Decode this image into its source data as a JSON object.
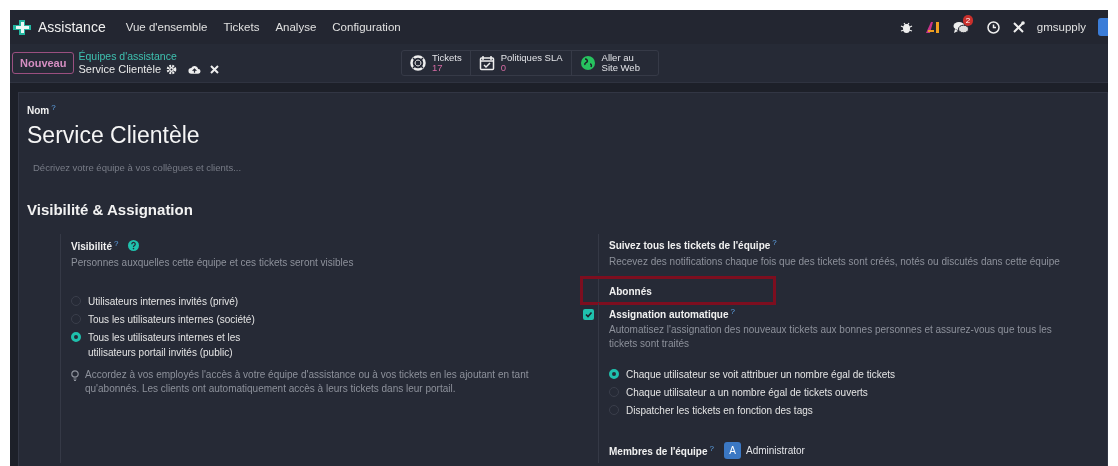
{
  "navbar": {
    "app_name": "Assistance",
    "menu": [
      "Vue d'ensemble",
      "Tickets",
      "Analyse",
      "Configuration"
    ],
    "chat_badge": "2",
    "user": "gmsupply"
  },
  "control_panel": {
    "new_button": "Nouveau",
    "breadcrumb": "Équipes d'assistance",
    "record": "Service Clientèle",
    "stat_buttons": [
      {
        "kind": "tickets",
        "label": "Tickets",
        "value": "17"
      },
      {
        "kind": "sla",
        "label": "Politiques SLA",
        "value": "0"
      },
      {
        "kind": "website",
        "label": "Aller au Site Web"
      }
    ]
  },
  "form": {
    "name_label": "Nom",
    "name_help": "?",
    "name": "Service Clientèle",
    "description_placeholder": "Décrivez votre équipe à vos collègues et clients...",
    "section_title": "Visibilité & Assignation",
    "visibility": {
      "label": "Visibilité",
      "help": "?",
      "description": "Personnes auxquelles cette équipe et ces tickets seront visibles",
      "options": [
        {
          "label": "Utilisateurs internes invités (privé)",
          "selected": false
        },
        {
          "label": "Tous les utilisateurs internes (société)",
          "selected": false
        },
        {
          "label": "Tous les utilisateurs internes et les utilisateurs portail invités (public)",
          "selected": true
        }
      ],
      "tip": "Accordez à vos employés l'accès à votre équipe d'assistance ou à vos tickets en les ajoutant en tant qu'abonnés. Les clients ont automatiquement accès à leurs tickets dans leur portail."
    },
    "settings": [
      {
        "kind": "text",
        "label": "Suivez tous les tickets de l'équipe",
        "help": "?",
        "description": "Recevez des notifications chaque fois que des tickets sont créés, notés ou discutés dans cette équipe"
      },
      {
        "kind": "field",
        "label": "Abonnés",
        "highlighted": true
      },
      {
        "kind": "checkbox",
        "checked": true,
        "label": "Assignation automatique",
        "help": "?",
        "description": "Automatisez l'assignation des nouveaux tickets aux bonnes personnes et assurez-vous que tous les tickets sont traités",
        "options": [
          {
            "label": "Chaque utilisateur se voit attribuer un nombre égal de tickets",
            "selected": true
          },
          {
            "label": "Chaque utilisateur a un nombre égal de tickets ouverts",
            "selected": false
          },
          {
            "label": "Dispatcher les tickets en fonction des tags",
            "selected": false
          }
        ]
      },
      {
        "kind": "members",
        "label": "Membres de l'équipe",
        "help": "?",
        "members": [
          {
            "initial": "A",
            "name": "Administrator"
          }
        ]
      }
    ]
  }
}
